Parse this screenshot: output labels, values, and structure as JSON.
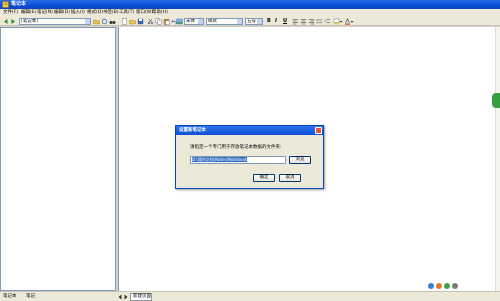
{
  "window": {
    "title": "笔记本"
  },
  "menu": [
    "文件(F)",
    "编辑(E)",
    "笔记(N)",
    "编辑(D)",
    "插入(I)",
    "格式(O)",
    "书签(B)",
    "工具(T)",
    "窗口(W)",
    "帮助(H)"
  ],
  "toolbar": {
    "notebook_select": "[笔记本]",
    "font_select": "宋体",
    "style_select": "样式",
    "size_select": "五号",
    "bold_label": "B",
    "italic_label": "I",
    "underline_label": "U"
  },
  "dialog": {
    "title": "设置新笔记本",
    "prompt": "请指定一个专门用于存放笔记本数据的文件夹:",
    "path_value": "D:\\我的文档\\Notes\\Notebook",
    "browse_label": "浏览",
    "ok_label": "确定",
    "cancel_label": "取消"
  },
  "status": {
    "left_label": "笔记本",
    "left_sub": "笔记",
    "page_tab": "新建页面"
  },
  "colors": {
    "titlebar": "#0a4fd6",
    "side_tab": "#35a040"
  }
}
